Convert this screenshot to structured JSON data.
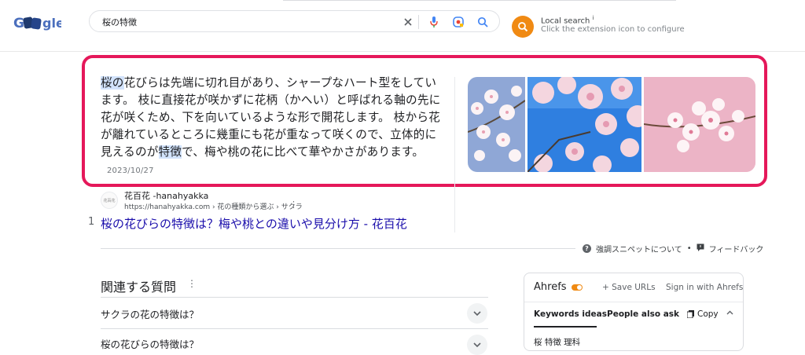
{
  "header": {
    "logo_text": "Google",
    "search_query": "桜の特徴",
    "local_search": {
      "title": "Local search",
      "info_mark": "i",
      "subtitle": "Click the extension icon to configure"
    }
  },
  "snippet": {
    "text_parts": [
      {
        "text": "桜の",
        "highlight": true
      },
      {
        "text": "花びらは先端に切れ目があり、シャープなハート型をしています。 枝に直接花が咲かずに花柄（かへい）と呼ばれる軸の先に花が咲くため、下を向いているような形で開花します。 枝から花が離れているところに幾重にも花が重なって咲くので、立体的に見えるのが",
        "highlight": false
      },
      {
        "text": "特徴",
        "highlight": true
      },
      {
        "text": "で、梅や桃の花に比べて華やかさがあります。",
        "highlight": false
      }
    ],
    "date": "2023/10/27",
    "images": [
      "cherry-blossom-closeup",
      "cherry-blossom-blue-sky",
      "cherry-blossom-pink"
    ]
  },
  "source": {
    "favicon_text": "花百花",
    "site_name": "花百花 -hanahyakka",
    "url": "https://hanahyakka.com › 花の種類から選ぶ › サクラ",
    "rank": "1",
    "title": "桜の花びらの特徴は？梅や桃との違いや見分け方 - 花百花"
  },
  "feedback": {
    "about": "強調スニペットについて",
    "separator": "•",
    "feedback_label": "フィードバック"
  },
  "paa": {
    "title": "関連する質問",
    "questions": [
      "サクラの花の特徴は？",
      "桜の花びらの特徴は？"
    ]
  },
  "ahrefs": {
    "brand": "Ahrefs",
    "save_urls": "+ Save URLs",
    "sign_in": "Sign in with Ahrefs",
    "tab_keywords": "Keywords ideas",
    "tab_people": "People also ask",
    "copy": "Copy",
    "first_row": "桜 特徴 理科"
  },
  "colors": {
    "accent_pink": "#e5185a",
    "link_blue": "#1a0dab",
    "ahrefs_orange": "#f08a13"
  }
}
